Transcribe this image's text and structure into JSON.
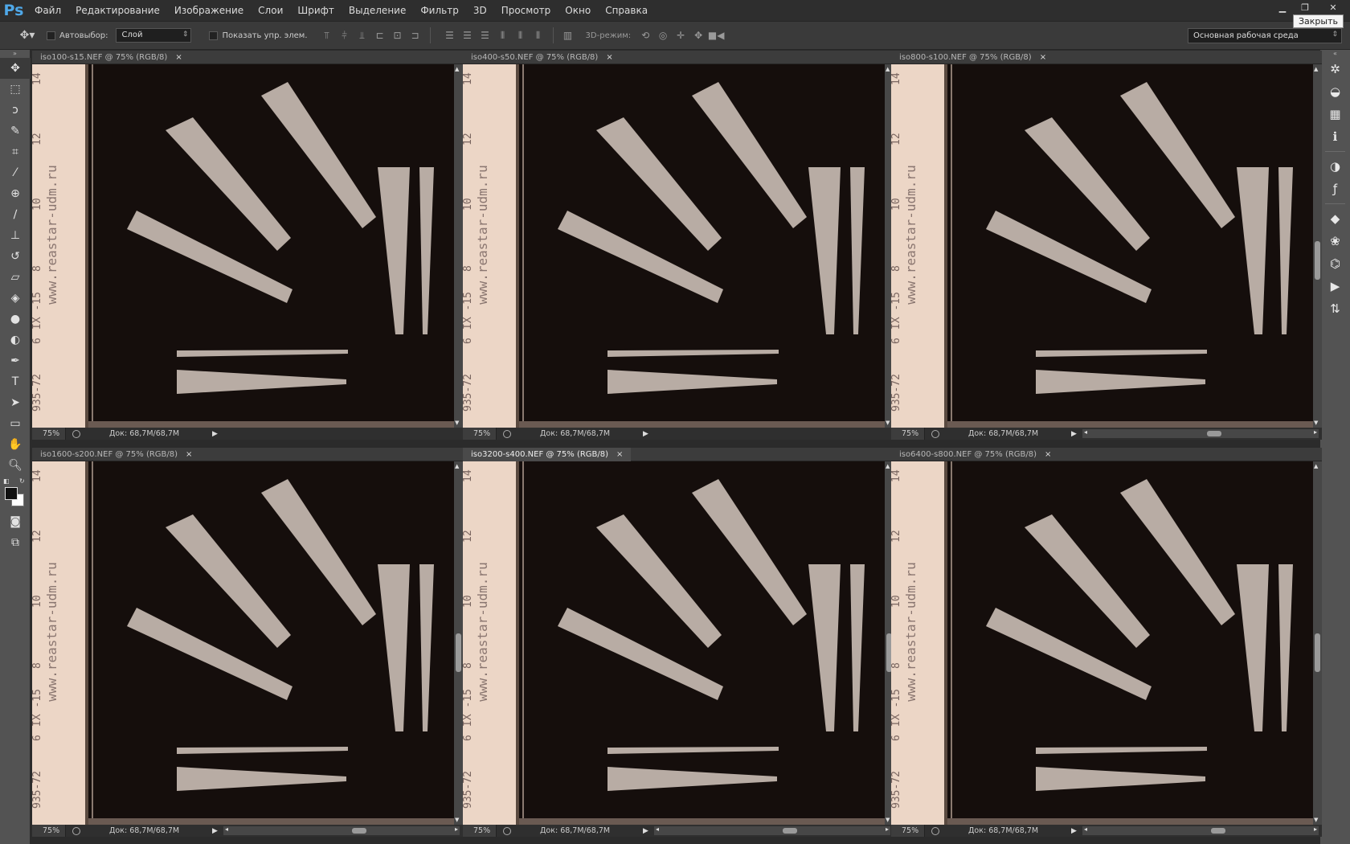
{
  "app": {
    "logo": "Ps"
  },
  "menu": [
    "Файл",
    "Редактирование",
    "Изображение",
    "Слои",
    "Шрифт",
    "Выделение",
    "Фильтр",
    "3D",
    "Просмотр",
    "Окно",
    "Справка"
  ],
  "window": {
    "tooltip": "Закрыть"
  },
  "options": {
    "autoselect_label": "Автовыбор:",
    "autoselect_value": "Слой",
    "show_controls_label": "Показать упр. элем.",
    "mode_3d_label": "3D-режим:",
    "workspace": "Основная рабочая среда"
  },
  "documents": [
    {
      "title": "iso100-s15.NEF @ 75% (RGB/8)",
      "zoom": "75%",
      "doc_size": "Док: 68,7M/68,7M",
      "active": false
    },
    {
      "title": "iso400-s50.NEF @ 75% (RGB/8)",
      "zoom": "75%",
      "doc_size": "Док: 68,7M/68,7M",
      "active": false
    },
    {
      "title": "iso800-s100.NEF @ 75% (RGB/8)",
      "zoom": "75%",
      "doc_size": "Док: 68,7M/68,7M",
      "active": false
    },
    {
      "title": "iso1600-s200.NEF @ 75% (RGB/8)",
      "zoom": "75%",
      "doc_size": "Док: 68,7M/68,7M",
      "active": false
    },
    {
      "title": "iso3200-s400.NEF @ 75% (RGB/8)",
      "zoom": "75%",
      "doc_size": "Док: 68,7M/68,7M",
      "active": true
    },
    {
      "title": "iso6400-s800.NEF @ 75% (RGB/8)",
      "zoom": "75%",
      "doc_size": "Док: 68,7M/68,7M",
      "active": false
    }
  ],
  "photo": {
    "ruler_text": "www.reastar-udm.ru",
    "ruler_marks": [
      "14",
      "12",
      "10",
      "8",
      "IX -15",
      "6",
      "935-72"
    ]
  },
  "tools": [
    "move-icon",
    "marquee-icon",
    "lasso-icon",
    "quick-select-icon",
    "crop-icon",
    "eyedropper-icon",
    "healing-icon",
    "brush-icon",
    "stamp-icon",
    "history-brush-icon",
    "eraser-icon",
    "bucket-icon",
    "blur-icon",
    "dodge-icon",
    "pen-icon",
    "type-icon",
    "path-select-icon",
    "shape-icon",
    "hand-icon",
    "zoom-icon"
  ],
  "panels": [
    "navigator-icon",
    "color-icon",
    "swatches-icon",
    "info-icon",
    "adjustments-icon",
    "styles-icon",
    "layers-icon",
    "channels-icon",
    "paths-icon",
    "actions-icon",
    "history-icon"
  ],
  "colors": {
    "accent": "#4fa8e8",
    "paper": "#ecd6c6",
    "photo_bg": "#150e0c",
    "chart": "#b8aca4"
  }
}
